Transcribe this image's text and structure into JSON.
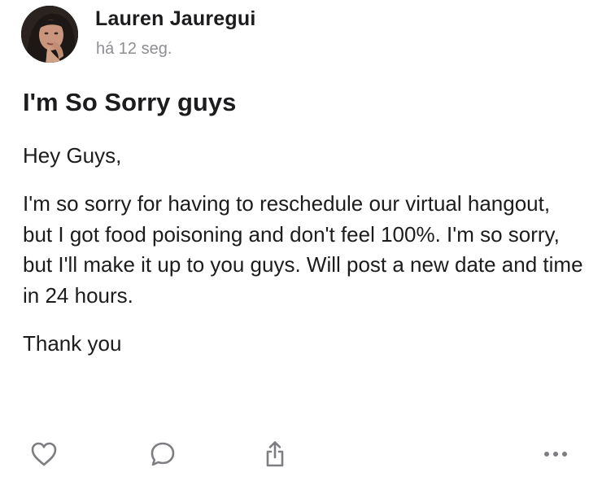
{
  "post": {
    "author": {
      "name": "Lauren Jauregui",
      "avatar_icon": "profile-photo"
    },
    "timestamp": "há 12 seg.",
    "title": "I'm So Sorry guys",
    "body": {
      "greeting": "Hey Guys,",
      "message": "I'm so sorry for having to reschedule our virtual hangout, but I got food poisoning and don't feel 100%. I'm so sorry, but I'll make it up to you guys. Will post a new date and time in 24 hours.",
      "closing": "Thank you"
    }
  },
  "actions": {
    "like_icon": "heart-icon",
    "comment_icon": "speech-bubble-icon",
    "share_icon": "share-icon",
    "more_icon": "more-horizontal-icon"
  },
  "colors": {
    "text": "#1c1c1e",
    "secondary_text": "#8e8e93",
    "icon": "#7d7d82",
    "background": "#ffffff"
  }
}
